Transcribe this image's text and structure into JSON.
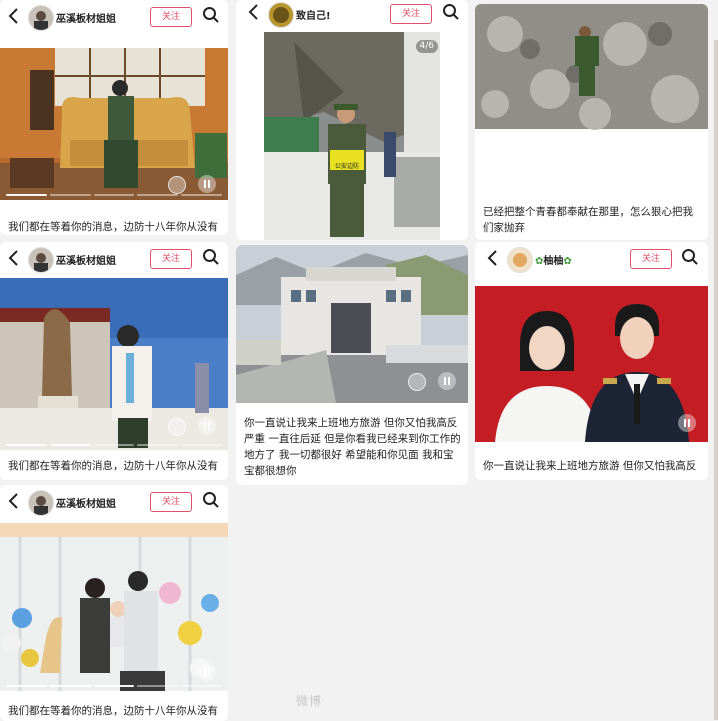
{
  "header": {
    "back_icon": "back-arrow-icon",
    "search_icon": "search-icon",
    "follow_label": "关注"
  },
  "users": {
    "wuxi": "巫溪板材姐姐",
    "zhiziji": "致自己!",
    "youyou": "柚柚"
  },
  "cards": [
    {
      "id": "c1",
      "caption": "我们都在等着你的消息，边防十八年你从没有"
    },
    {
      "id": "c2",
      "counter": "4/6"
    },
    {
      "id": "c3",
      "caption": "已经把整个青春都奉献在那里，怎么狠心把我们家抛弃"
    },
    {
      "id": "c4",
      "caption": "我们都在等着你的消息，边防十八年你从没有"
    },
    {
      "id": "c5",
      "caption": "你一直说让我来上班地方旅游 但你又怕我高反严重 一直往后延 但是你看我已经来到你工作的地方了 我一切都很好 希望能和你见面 我和宝宝都很想你"
    },
    {
      "id": "c6",
      "caption": "你一直说让我来上班地方旅游 但你又怕我高反"
    },
    {
      "id": "c7",
      "caption": "我们都在等着你的消息，边防十八年你从没有"
    }
  ],
  "photo_texts": {
    "police_badge": "公安边防"
  },
  "watermark": "微博",
  "colors": {
    "follow": "#e0506a",
    "page_bg": "#f2f2f2"
  }
}
